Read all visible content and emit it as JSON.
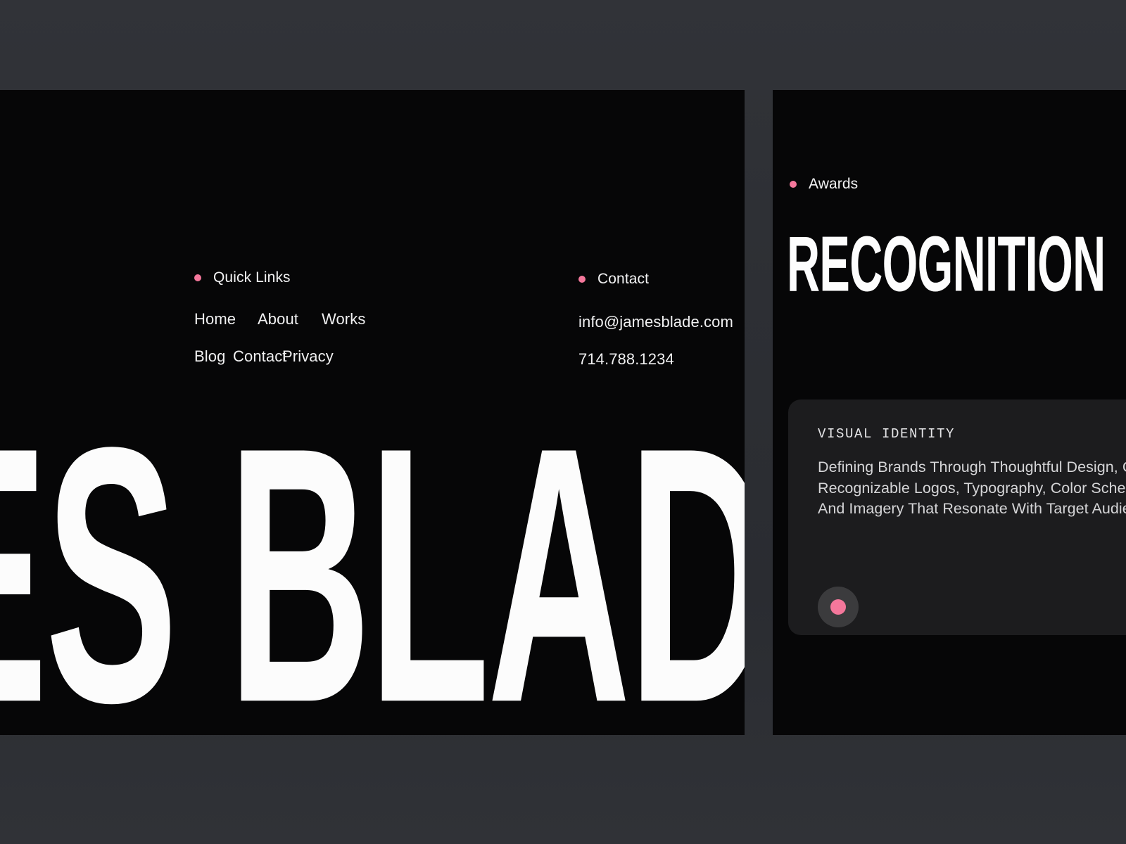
{
  "brand": {
    "wordmark": "ES BLADE",
    "registered_mark": "®"
  },
  "footer": {
    "quick_links": {
      "label": "Quick Links",
      "marker": "bullet-dot-icon",
      "rows": [
        [
          "Home",
          "About",
          "Works"
        ],
        [
          "Blog",
          "Contact",
          "Privacy"
        ]
      ]
    },
    "contact": {
      "label": "Contact",
      "marker": "bullet-dot-icon",
      "email": "info@jamesblade.com",
      "phone": "714.788.1234"
    }
  },
  "awards_panel": {
    "label": "Awards",
    "marker": "bullet-dot-icon",
    "heading": "RECOGNITION",
    "card": {
      "kicker": "VISUAL IDENTITY",
      "body": "Defining Brands Through Thoughtful Design, Creating Recognizable Logos, Typography, Color Schemes, And Imagery That Resonate With Target Audiences.",
      "action_icon": "dot-button-icon"
    }
  },
  "colors": {
    "accent_pink": "#f4779b",
    "panel_black": "#060607",
    "card_surface": "#1c1c1e",
    "page_background": "#2e3036",
    "text_primary": "#f0f0f1",
    "text_body": "#d5d5d7"
  }
}
